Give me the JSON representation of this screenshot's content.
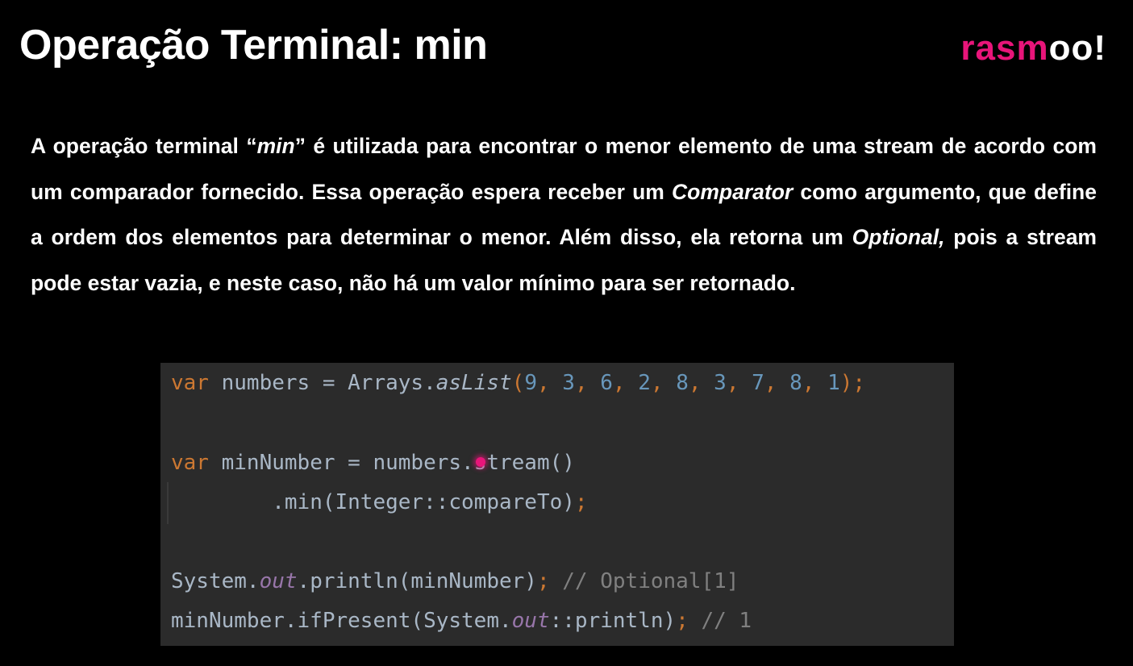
{
  "slide": {
    "title": "Operação Terminal: min",
    "logo": {
      "pink_part": "rasm",
      "white_part": "oo!",
      "brand_color": "#e8157a"
    },
    "paragraph": {
      "t1": "A operação terminal “",
      "t2": "min",
      "t3": "” é utilizada para encontrar o menor elemento de uma stream de acordo com um comparador fornecido. Essa operação espera receber um ",
      "t4": "Comparator",
      "t5": " como argumento, que define a ordem dos elementos para determinar o menor. Além disso, ela retorna um ",
      "t6": "Optional,",
      "t7": " pois a stream pode estar vazia, e neste caso, não há um valor mínimo para ser retornado."
    },
    "code": {
      "line1": {
        "kw": "var",
        "ident": " numbers = Arrays.",
        "method": "asList",
        "open": "(",
        "n1": "9",
        "n2": "3",
        "n3": "6",
        "n4": "2",
        "n5": "8",
        "n6": "3",
        "n7": "7",
        "n8": "8",
        "n9": "1",
        "comma": ", ",
        "close": ")",
        "semi": ";"
      },
      "line2": {
        "kw": "var",
        "ident": " minNumber = numbers.stream()"
      },
      "line3": {
        "indent": "        ",
        "call": ".min(Integer::compareTo)",
        "semi": ";"
      },
      "line4": {
        "pre": "System.",
        "field": "out",
        "post": ".println(minNumber)",
        "semi": ";",
        "comment": " // Optional[1]"
      },
      "line5": {
        "pre": "minNumber.ifPresent(System.",
        "field": "out",
        "post": "::println)",
        "semi": ";",
        "comment": " // 1"
      }
    }
  },
  "colors": {
    "background": "#000000",
    "code_background": "#2b2b2b",
    "keyword": "#cc7832",
    "number": "#6897bb",
    "default_code": "#a9b7c6",
    "static_field": "#9876aa",
    "comment": "#808080"
  }
}
